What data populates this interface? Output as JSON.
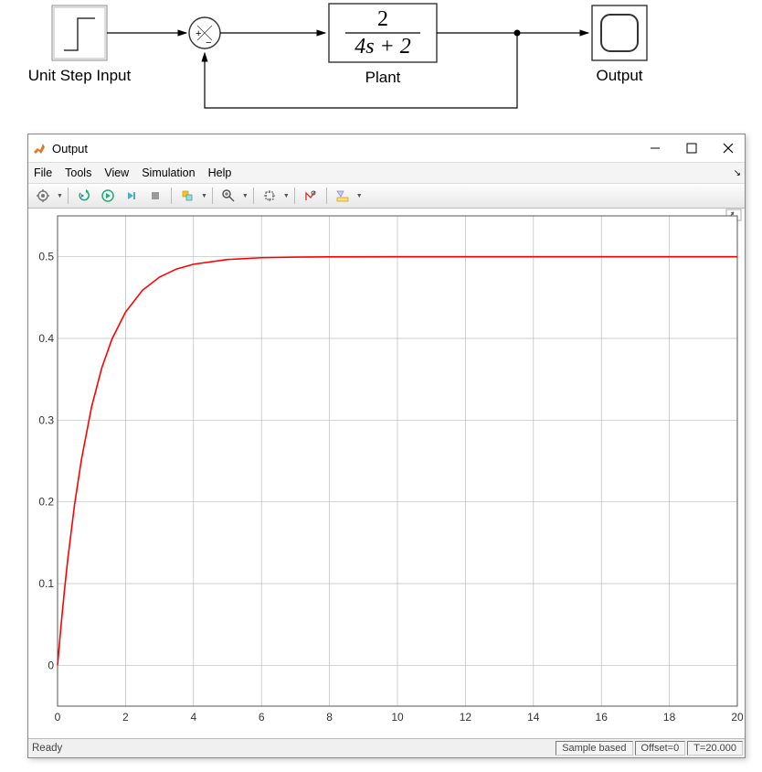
{
  "diagram": {
    "blocks": {
      "step": {
        "label": "Unit Step Input"
      },
      "sum": {
        "plus": "+",
        "minus": "−"
      },
      "plant": {
        "numerator": "2",
        "denominator": "4s + 2",
        "label": "Plant"
      },
      "scope": {
        "label": "Output"
      }
    }
  },
  "window": {
    "title": "Output",
    "menu": {
      "file": "File",
      "tools": "Tools",
      "view": "View",
      "simulation": "Simulation",
      "help": "Help"
    },
    "status": {
      "ready": "Ready",
      "sample": "Sample based",
      "offset": "Offset=0",
      "time": "T=20.000"
    }
  },
  "toolbar_icons": {
    "gear": "gear-icon",
    "print": "print-icon",
    "run": "run-icon",
    "step_forward": "step-forward-icon",
    "stop": "stop-icon",
    "highlight": "highlight-icon",
    "zoom": "zoom-icon",
    "pan": "pan-icon",
    "scale": "scale-icon",
    "measure": "measure-icon"
  },
  "chart_data": {
    "type": "line",
    "title": "",
    "xlabel": "",
    "ylabel": "",
    "xlim": [
      0,
      20
    ],
    "ylim": [
      -0.05,
      0.55
    ],
    "xticks": [
      0,
      2,
      4,
      6,
      8,
      10,
      12,
      14,
      16,
      18,
      20
    ],
    "yticks": [
      0,
      0.1,
      0.2,
      0.3,
      0.4,
      0.5
    ],
    "grid": true,
    "series": [
      {
        "name": "output",
        "color": "#ff0000",
        "x": [
          0,
          0.1,
          0.2,
          0.3,
          0.5,
          0.7,
          1.0,
          1.3,
          1.6,
          2.0,
          2.5,
          3.0,
          3.5,
          4.0,
          5.0,
          6.0,
          7.0,
          8.0,
          10.0,
          12.0,
          15.0,
          18.0,
          20.0
        ],
        "y": [
          0.0,
          0.0476,
          0.0906,
          0.1296,
          0.1967,
          0.2513,
          0.3161,
          0.3639,
          0.3992,
          0.4323,
          0.459,
          0.4751,
          0.485,
          0.4908,
          0.4966,
          0.4988,
          0.4995,
          0.4998,
          0.5,
          0.5,
          0.5,
          0.5,
          0.5
        ]
      }
    ]
  }
}
